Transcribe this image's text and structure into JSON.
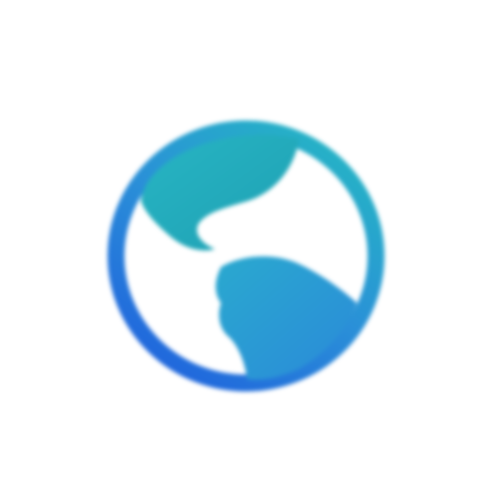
{
  "app_icon": {
    "icon": "globe-icon",
    "colors": {
      "teal": "#22a7b6",
      "aqua": "#27b3c4",
      "blue": "#2c7fe0",
      "deep_blue": "#1e66de",
      "background": "#ffffff"
    }
  }
}
